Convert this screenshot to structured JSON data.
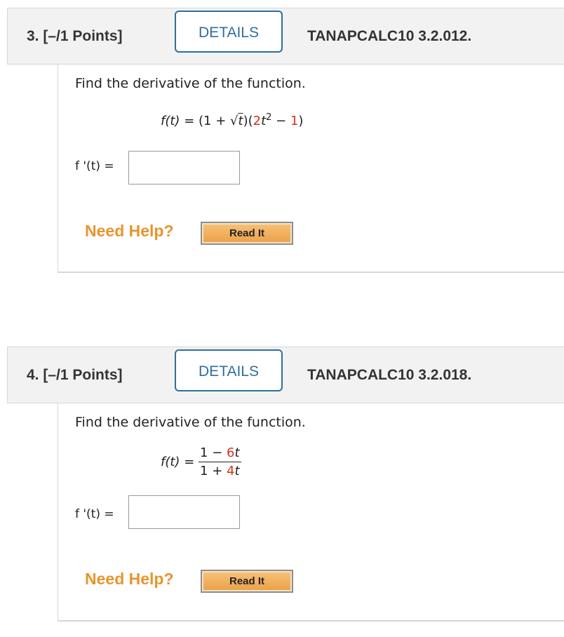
{
  "questions": [
    {
      "number_label": "3. [–/1 Points]",
      "details_label": "DETAILS",
      "code": "TANAPCALC10 3.2.012.",
      "prompt": "Find the derivative of the function.",
      "function": {
        "lhs": "f(t)",
        "eq": "=",
        "p1": "(1 + ",
        "sqrt_symbol": "√",
        "sqrt_arg": "t",
        "p2": ")(",
        "coef": "2",
        "var": "t",
        "exp": "2",
        "minus": " − ",
        "const": "1",
        "close": ")"
      },
      "answer_label": "f '(t)  =",
      "answer_value": "",
      "need_help": "Need Help?",
      "read_it": "Read It"
    },
    {
      "number_label": "4. [–/1 Points]",
      "details_label": "DETAILS",
      "code": "TANAPCALC10 3.2.018.",
      "prompt": "Find the derivative of the function.",
      "function": {
        "lhs": "f(t)",
        "eq": "=",
        "num_a": "1 − ",
        "num_b": "6",
        "num_var": "t",
        "den_a": "1 + ",
        "den_b": "4",
        "den_var": "t"
      },
      "answer_label": "f '(t)  =",
      "answer_value": "",
      "need_help": "Need Help?",
      "read_it": "Read It"
    }
  ],
  "colors": {
    "details_border": "#2f6e9e",
    "need_help": "#e8952c",
    "highlight_red": "#d6321e",
    "header_bg": "#f2f2f2"
  }
}
